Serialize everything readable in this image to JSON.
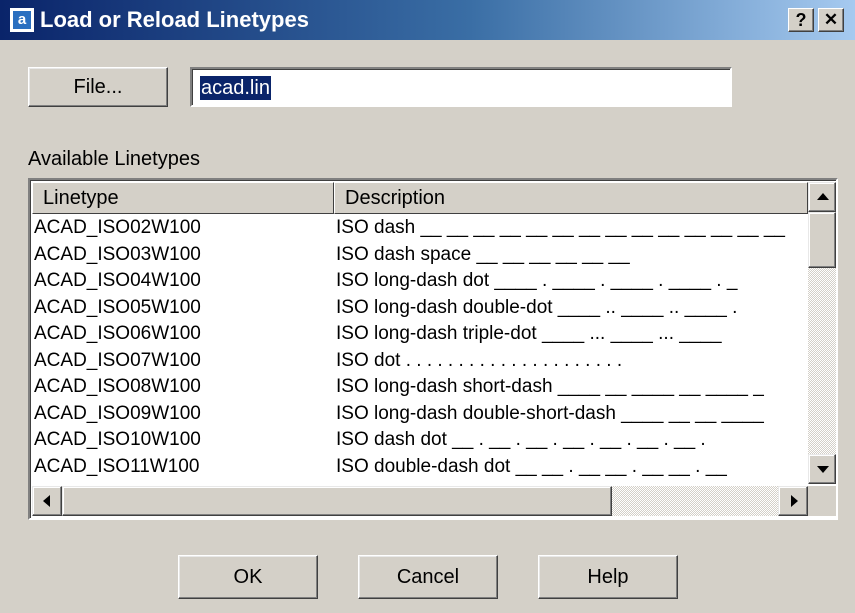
{
  "window": {
    "title": "Load or Reload Linetypes",
    "app_icon_glyph": "a",
    "help_glyph": "?",
    "close_glyph": "✕"
  },
  "file": {
    "button_label": "File...",
    "value": "acad.lin"
  },
  "list": {
    "label": "Available Linetypes",
    "columns": [
      "Linetype",
      "Description"
    ],
    "rows": [
      {
        "linetype": "ACAD_ISO02W100",
        "description": "ISO dash __ __ __ __ __ __ __ __ __ __ __ __ __ __"
      },
      {
        "linetype": "ACAD_ISO03W100",
        "description": "ISO dash space __    __    __    __    __    __"
      },
      {
        "linetype": "ACAD_ISO04W100",
        "description": "ISO long-dash dot ____ . ____ . ____ . ____ . _"
      },
      {
        "linetype": "ACAD_ISO05W100",
        "description": "ISO long-dash double-dot ____ .. ____ .. ____ ."
      },
      {
        "linetype": "ACAD_ISO06W100",
        "description": "ISO long-dash triple-dot ____ ... ____ ... ____"
      },
      {
        "linetype": "ACAD_ISO07W100",
        "description": "ISO dot . . . . . . . . . . . . . . . . . . . . ."
      },
      {
        "linetype": "ACAD_ISO08W100",
        "description": "ISO long-dash short-dash ____ __ ____ __ ____ _"
      },
      {
        "linetype": "ACAD_ISO09W100",
        "description": "ISO long-dash double-short-dash ____ __ __ ____"
      },
      {
        "linetype": "ACAD_ISO10W100",
        "description": "ISO dash dot __ . __ . __ . __ . __ . __ . __ ."
      },
      {
        "linetype": "ACAD_ISO11W100",
        "description": "ISO double-dash dot __ __ . __ __ . __ __ . __"
      }
    ]
  },
  "buttons": {
    "ok": "OK",
    "cancel": "Cancel",
    "help": "Help"
  }
}
